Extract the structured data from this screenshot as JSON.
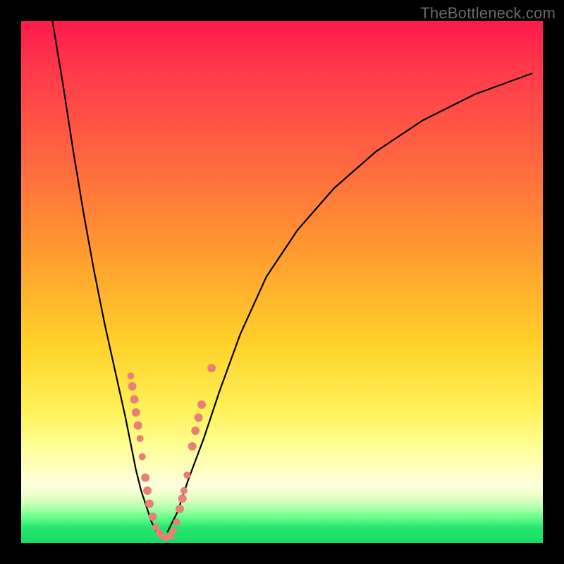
{
  "watermark": "TheBottleneck.com",
  "colors": {
    "frame": "#000000",
    "curve": "#000000",
    "dot": "#e98077",
    "gradient_top": "#ff1a4b",
    "gradient_bottom": "#17db62"
  },
  "chart_data": {
    "type": "line",
    "title": "",
    "xlabel": "",
    "ylabel": "",
    "xlim": [
      0,
      100
    ],
    "ylim": [
      0,
      100
    ],
    "grid": false,
    "legend": null,
    "annotations": [
      "TheBottleneck.com"
    ],
    "series": [
      {
        "name": "left-curve",
        "x": [
          6,
          8,
          10,
          12,
          14,
          16,
          18,
          20,
          21,
          22,
          23,
          24,
          25,
          26
        ],
        "y": [
          100,
          88,
          75,
          63,
          52,
          42,
          33,
          24,
          19,
          14,
          10,
          7,
          4,
          2
        ]
      },
      {
        "name": "right-curve",
        "x": [
          28,
          30,
          32,
          35,
          38,
          42,
          47,
          53,
          60,
          68,
          77,
          87,
          98
        ],
        "y": [
          2,
          6,
          12,
          20,
          29,
          40,
          51,
          60,
          68,
          75,
          81,
          86,
          90
        ]
      }
    ],
    "scatter": [
      {
        "name": "left-dots",
        "points": [
          {
            "x": 21.0,
            "y": 32.0,
            "r": 5
          },
          {
            "x": 21.3,
            "y": 30.0,
            "r": 6
          },
          {
            "x": 21.7,
            "y": 27.5,
            "r": 6
          },
          {
            "x": 22.0,
            "y": 25.0,
            "r": 6
          },
          {
            "x": 22.4,
            "y": 22.5,
            "r": 6
          },
          {
            "x": 22.8,
            "y": 20.0,
            "r": 5
          },
          {
            "x": 23.2,
            "y": 16.5,
            "r": 5
          },
          {
            "x": 23.8,
            "y": 12.5,
            "r": 6
          },
          {
            "x": 24.2,
            "y": 10.0,
            "r": 6
          },
          {
            "x": 24.6,
            "y": 7.5,
            "r": 6
          },
          {
            "x": 25.2,
            "y": 5.0,
            "r": 6
          },
          {
            "x": 25.8,
            "y": 3.0,
            "r": 5
          },
          {
            "x": 26.4,
            "y": 2.0,
            "r": 5
          },
          {
            "x": 27.0,
            "y": 1.3,
            "r": 5
          },
          {
            "x": 27.8,
            "y": 1.0,
            "r": 5
          }
        ]
      },
      {
        "name": "right-dots",
        "points": [
          {
            "x": 28.6,
            "y": 1.3,
            "r": 5
          },
          {
            "x": 29.2,
            "y": 2.3,
            "r": 5
          },
          {
            "x": 29.8,
            "y": 4.0,
            "r": 5
          },
          {
            "x": 30.4,
            "y": 6.5,
            "r": 6
          },
          {
            "x": 30.9,
            "y": 8.5,
            "r": 6
          },
          {
            "x": 31.2,
            "y": 10.0,
            "r": 5
          },
          {
            "x": 31.8,
            "y": 13.0,
            "r": 5
          },
          {
            "x": 32.8,
            "y": 18.5,
            "r": 6
          },
          {
            "x": 33.4,
            "y": 21.5,
            "r": 6
          },
          {
            "x": 34.0,
            "y": 24.0,
            "r": 6
          },
          {
            "x": 34.6,
            "y": 26.5,
            "r": 6
          },
          {
            "x": 36.5,
            "y": 33.5,
            "r": 6
          }
        ]
      }
    ]
  }
}
